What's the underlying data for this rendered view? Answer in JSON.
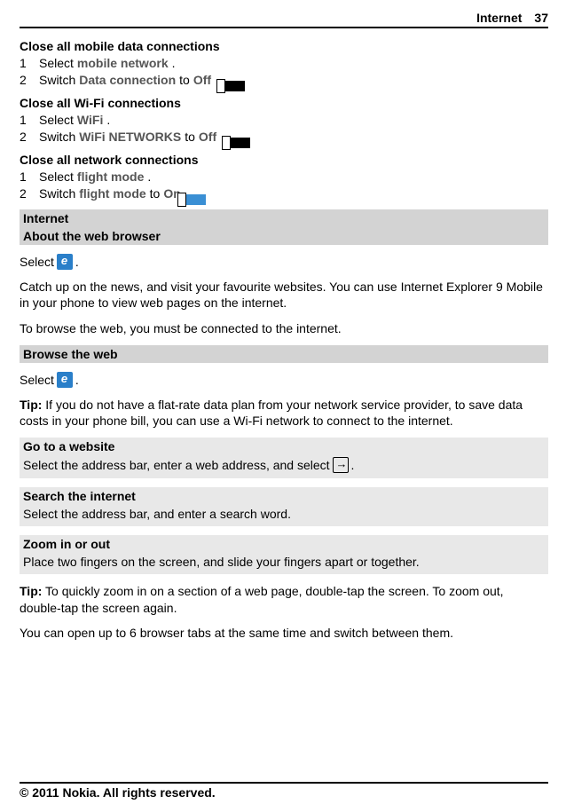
{
  "header": {
    "section": "Internet",
    "page": "37"
  },
  "sec1": {
    "title": "Close all mobile data connections",
    "step1_pre": "Select ",
    "step1_emph": "mobile network",
    "step1_post": ".",
    "step2_pre": "Switch ",
    "step2_emph": "Data connection",
    "step2_mid": " to ",
    "step2_emph2": "Off",
    "step2_post": "."
  },
  "sec2": {
    "title": "Close all Wi-Fi connections",
    "step1_pre": "Select ",
    "step1_emph": "WiFi",
    "step1_post": ".",
    "step2_pre": "Switch ",
    "step2_emph": "WiFi NETWORKS",
    "step2_mid": " to ",
    "step2_emph2": "Off",
    "step2_post": "."
  },
  "sec3": {
    "title": "Close all network connections",
    "step1_pre": "Select ",
    "step1_emph": "flight mode",
    "step1_post": ".",
    "step2_pre": "Switch ",
    "step2_emph": "flight mode",
    "step2_mid": " to ",
    "step2_emph2": "On",
    "step2_post": "."
  },
  "h_internet": "Internet",
  "h_about": "About the web browser",
  "select_pre": "Select ",
  "select_post": ".",
  "about_p1": "Catch up on the news, and visit your favourite websites. You can use Internet Explorer 9 Mobile in your phone to view web pages on the internet.",
  "about_p2": "To browse the web, you must be connected to the internet.",
  "h_browse": "Browse the web",
  "tip_label": "Tip:",
  "browse_tip": " If you do not have a flat-rate data plan from your network service provider, to save data costs in your phone bill, you can use a Wi-Fi network to connect to the internet.",
  "h_goto": "Go to a website",
  "goto_body_pre": "Select the address bar, enter a web address, and select ",
  "goto_body_post": ".",
  "h_search": "Search the internet",
  "search_body": "Select the address bar, and enter a search word.",
  "h_zoom": "Zoom in or out",
  "zoom_body": "Place two fingers on the screen, and slide your fingers apart or together.",
  "zoom_tip": " To quickly zoom in on a section of a web page, double-tap the screen. To zoom out, double-tap the screen again.",
  "tabs_p": "You can open up to 6 browser tabs at the same time and switch between them.",
  "footer": "© 2011 Nokia. All rights reserved.",
  "nums": {
    "n1": "1",
    "n2": "2"
  }
}
